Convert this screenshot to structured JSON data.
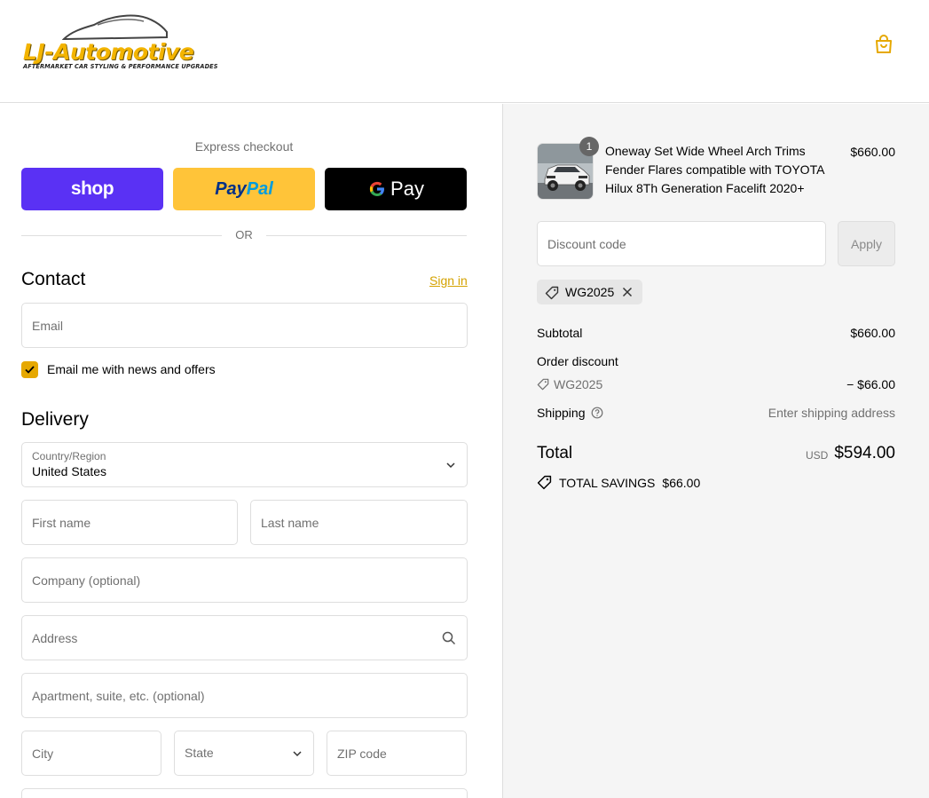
{
  "brand": {
    "name": "LJ-Automotive",
    "tagline": "AFTERMARKET CAR STYLING & PERFORMANCE UPGRADES",
    "accent": "#f3b400"
  },
  "header": {
    "cart_icon": "shopping-bag-icon"
  },
  "express": {
    "title": "Express checkout",
    "shop_label": "shop",
    "paypal_a": "Pay",
    "paypal_b": "Pal",
    "gpay_label": "Pay",
    "or_label": "OR"
  },
  "contact": {
    "title": "Contact",
    "sign_in": "Sign in",
    "email_placeholder": "Email",
    "news_label": "Email me with news and offers",
    "news_checked": true
  },
  "delivery": {
    "title": "Delivery",
    "country_label": "Country/Region",
    "country_value": "United States",
    "first_name": "First name",
    "last_name": "Last name",
    "company": "Company (optional)",
    "address": "Address",
    "apartment": "Apartment, suite, etc. (optional)",
    "city": "City",
    "state": "State",
    "zip": "ZIP code"
  },
  "order": {
    "product": {
      "title": "Oneway Set Wide Wheel Arch Trims Fender Flares compatible with TOYOTA Hilux 8Th Generation Facelift 2020+",
      "price": "$660.00",
      "quantity": "1"
    },
    "discount_placeholder": "Discount code",
    "apply_label": "Apply",
    "applied_code": "WG2025",
    "subtotal_label": "Subtotal",
    "subtotal_value": "$660.00",
    "order_discount_label": "Order discount",
    "discount_code": "WG2025",
    "discount_value": "− $66.00",
    "shipping_label": "Shipping",
    "shipping_value": "Enter shipping address",
    "total_label": "Total",
    "currency": "USD",
    "total_value": "$594.00",
    "savings_label": "TOTAL SAVINGS",
    "savings_value": "$66.00"
  }
}
